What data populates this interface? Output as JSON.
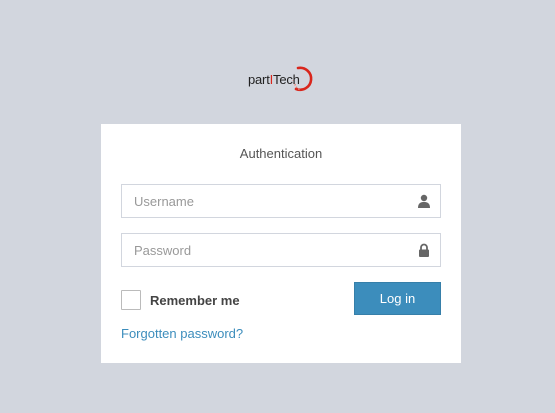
{
  "logo": {
    "text_prefix": "part",
    "text_accent": "I",
    "text_suffix": "Tech",
    "accent_color": "#d9261c"
  },
  "auth": {
    "title": "Authentication",
    "username_placeholder": "Username",
    "username_value": "",
    "password_placeholder": "Password",
    "password_value": "",
    "remember_label": "Remember me",
    "remember_checked": false,
    "login_label": "Log in",
    "forgot_label": "Forgotten password?"
  },
  "icons": {
    "username": "user-icon",
    "password": "lock-icon"
  },
  "colors": {
    "page_background": "#d2d6de",
    "primary": "#3c8dbc",
    "link": "#3c8dbc"
  }
}
